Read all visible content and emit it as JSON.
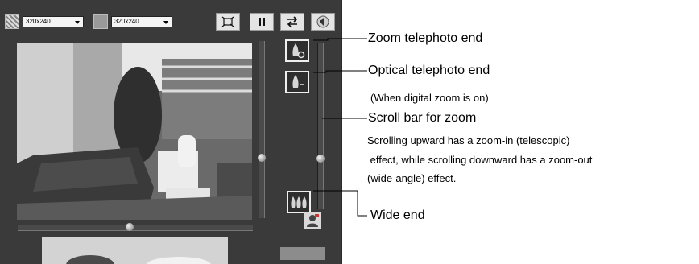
{
  "toolbar": {
    "size_select_1": "320x240",
    "size_select_2": "320x240",
    "buttons": [
      {
        "name": "fullscreen-button",
        "glyph": "⛶",
        "icon": "fullscreen-icon"
      },
      {
        "name": "pause-button",
        "glyph": "❚❚",
        "icon": "pause-icon"
      },
      {
        "name": "swap-button",
        "glyph": "⇄",
        "icon": "swap-icon"
      },
      {
        "name": "audio-button",
        "glyph": "🔈",
        "icon": "speaker-icon"
      }
    ]
  },
  "callouts": {
    "zoom_telephoto": "Zoom telephoto end",
    "optical_telephoto": "Optical telephoto end",
    "digital_zoom_note": "(When digital zoom is on)",
    "scroll_bar": "Scroll bar for zoom",
    "scroll_desc_1": "Scrolling upward has a zoom-in (telescopic)",
    "scroll_desc_2": " effect, while scrolling downward has a zoom-out",
    "scroll_desc_3": "(wide-angle) effect.",
    "wide_end": "Wide end"
  },
  "colors": {
    "panel": "#3a3a3a",
    "highlight_border": "#efefef"
  }
}
